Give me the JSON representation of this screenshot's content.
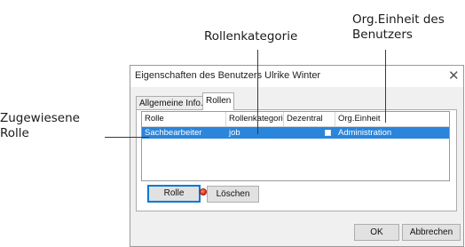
{
  "annotations": {
    "assigned_role": [
      "Zugewiesene",
      "Rolle"
    ],
    "role_category": "Rollenkategorie",
    "org_unit_of_user": [
      "Org.Einheit des",
      "Benutzers"
    ]
  },
  "dialog": {
    "title": "Eigenschaften des Benutzers Ulrike Winter",
    "close_glyph": "✕"
  },
  "tabs": [
    {
      "label": "Allgemeine Info.",
      "active": false
    },
    {
      "label": "Rollen",
      "active": true
    }
  ],
  "roles_table": {
    "columns": [
      "Rolle",
      "Rollenkategori",
      "Dezentral",
      "Org.Einheit"
    ],
    "rows": [
      {
        "role": "Sachbearbeiter",
        "category": "job",
        "decentral": true,
        "org_unit": "Administration",
        "selected": true
      }
    ]
  },
  "buttons": {
    "role": "Rolle",
    "delete": "Löschen",
    "ok": "OK",
    "cancel": "Abbrechen"
  },
  "colors": {
    "selection": "#2a85db",
    "focus_border": "#0078d7",
    "delete_indicator": "#d7301a"
  }
}
